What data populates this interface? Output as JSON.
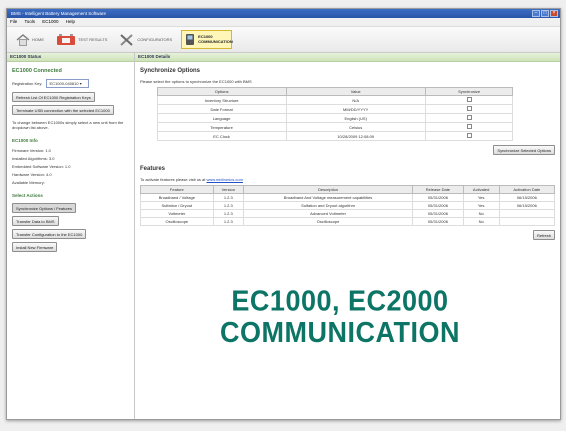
{
  "window": {
    "title": "BMS - Intelligent Battery Management Software"
  },
  "menu": [
    "File",
    "Tools",
    "EC1000",
    "Help"
  ],
  "toolbar": {
    "home": "HOME",
    "results": "TEST RESULTS",
    "config": "CONFIGURATORS",
    "comm": "EC1000 COMMUNICATION"
  },
  "left": {
    "header": "EC1000 Status",
    "connected": "EC1000 Connected",
    "reg_label": "Registration Key:",
    "reg_value": "EC1000-040810",
    "refresh_btn": "Refresh List Of EC1000 Registration Keys",
    "terminate_btn": "Terminate USB connection with the selected EC1000",
    "change_note": "To change between EC1000s simply select a new unit from the dropdown list above.",
    "info_title": "EC1000 Info",
    "info": [
      "Firmware Version: 1.0",
      "Installed Algorithms: 3.0",
      "Embedded Software Version: 1.0",
      "Hardware Version: 4.0",
      "Available Memory:"
    ],
    "actions_title": "Select Actions",
    "actions": [
      "Synchronize Options / Features",
      "Transfer Data to BMS",
      "Transfer Configuration to the EC1000",
      "Install New Firmware"
    ]
  },
  "right": {
    "header": "EC1000 Details",
    "sync_title": "Synchronize Options",
    "sync_desc": "Please select the options to synchronize the EC1000 with BMS",
    "sync_cols": [
      "Options",
      "Value",
      "Synchronize"
    ],
    "sync_rows": [
      [
        "Inventory Structure",
        "N/A"
      ],
      [
        "Date Format",
        "MM/DD/YYYY"
      ],
      [
        "Language",
        "English (US)"
      ],
      [
        "Temperature",
        "Celsius"
      ],
      [
        "EC Clock",
        "10/28/2009 12:08:09"
      ]
    ],
    "sync_btn": "Synchronize Selected Options",
    "features_title": "Features",
    "features_desc": "To activate features please visit us at",
    "features_link": "www.midtronics.com",
    "feat_cols": [
      "Feature",
      "Version",
      "Description",
      "Release Date",
      "Activated",
      "Activation Date"
    ],
    "feat_rows": [
      [
        "Broadband / Voltage",
        "1.2.3",
        "Broadband And Voltage measurement capabilities",
        "05/31/2006",
        "Yes",
        "06/15/2006"
      ],
      [
        "Sulfation / Dryout",
        "1.2.3",
        "Sulfation and Dryout algorithm",
        "05/31/2006",
        "Yes",
        "06/15/2006"
      ],
      [
        "Voltmeter",
        "1.2.3",
        "Advanced Voltmeter",
        "05/31/2006",
        "No",
        ""
      ],
      [
        "Oscilloscope",
        "1.2.3",
        "Oscilloscope",
        "05/31/2006",
        "No",
        ""
      ]
    ],
    "refresh_btn": "Refresh"
  },
  "overlay": {
    "line1": "EC1000, EC2000",
    "line2": "COMMUNICATION"
  },
  "colors": {
    "overlay": "#0c7565",
    "pane_header": "#cde3b8",
    "section": "#3e7a3a"
  }
}
